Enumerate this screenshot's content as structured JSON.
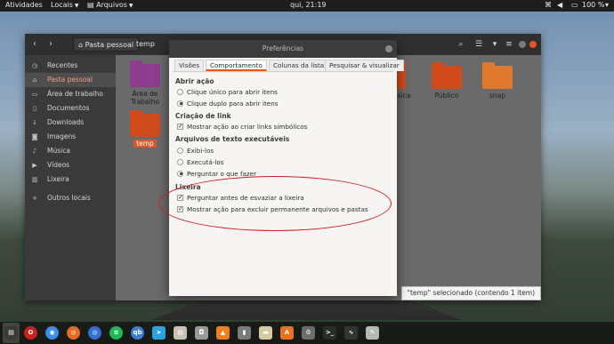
{
  "topbar": {
    "activities": "Atividades",
    "locais": "Locais",
    "arquivos": "Arquivos",
    "clock": "qui, 21:19",
    "battery": "100 %"
  },
  "nautilus": {
    "back_icon": "chevron-left-icon",
    "breadcrumb_home": "Pasta pessoal",
    "breadcrumb_temp": "temp",
    "sidebar": [
      {
        "icon": "clock-icon",
        "label": "Recentes"
      },
      {
        "icon": "home-icon",
        "label": "Pasta pessoal"
      },
      {
        "icon": "desktop-icon",
        "label": "Área de trabalho"
      },
      {
        "icon": "document-icon",
        "label": "Documentos"
      },
      {
        "icon": "download-icon",
        "label": "Downloads"
      },
      {
        "icon": "camera-icon",
        "label": "Imagens"
      },
      {
        "icon": "music-icon",
        "label": "Música"
      },
      {
        "icon": "video-icon",
        "label": "Vídeos"
      },
      {
        "icon": "trash-icon",
        "label": "Lixeira"
      },
      {
        "icon": "plus-icon",
        "label": "Outros locais"
      }
    ],
    "folders": [
      {
        "label": "Área de Trabalho",
        "color": "#8e3c8e"
      },
      {
        "label": "temp",
        "color": "#d14a1c"
      },
      {
        "label": "úsica",
        "color": "#d14a1c"
      },
      {
        "label": "Público",
        "color": "#d14a1c"
      },
      {
        "label": "snap",
        "color": "#e0782e"
      }
    ],
    "status": "\"temp\" selecionado  (contendo 1 item)"
  },
  "dialog": {
    "title": "Preferências",
    "tabs": [
      "Visões",
      "Comportamento",
      "Colunas da lista",
      "Pesquisar & visualizar"
    ],
    "sections": {
      "abrir": {
        "title": "Abrir ação",
        "options": [
          "Clique único para abrir itens",
          "Clique duplo para abrir itens"
        ]
      },
      "link": {
        "title": "Criação de link",
        "options": [
          "Mostrar ação ao criar links simbólicos"
        ]
      },
      "exec": {
        "title": "Arquivos de texto executáveis",
        "options": [
          "Exibi-los",
          "Executá-los",
          "Perguntar o que fazer"
        ]
      },
      "lixeira": {
        "title": "Lixeira",
        "options": [
          "Perguntar antes de esvaziar a lixeira",
          "Mostrar ação para excluir permanente arquivos e pastas"
        ]
      }
    }
  },
  "dock": [
    {
      "icon": "opera-icon",
      "glyph": "O",
      "color": "#cc1f1f"
    },
    {
      "icon": "chrome-icon",
      "glyph": "◉",
      "color": "#3a8ee6"
    },
    {
      "icon": "firefox-icon",
      "glyph": "◎",
      "color": "#e66a1f"
    },
    {
      "icon": "firefox-dev-icon",
      "glyph": "◎",
      "color": "#2f6fd6"
    },
    {
      "icon": "spotify-icon",
      "glyph": "≋",
      "color": "#1db954"
    },
    {
      "icon": "qbittorrent-icon",
      "glyph": "qb",
      "color": "#3b7ed3"
    },
    {
      "icon": "telegram-icon",
      "glyph": "➤",
      "color": "#2aa3df"
    },
    {
      "icon": "files-icon",
      "glyph": "▤",
      "color": "#c9c2b4"
    },
    {
      "icon": "screenshot-icon",
      "glyph": "◘",
      "color": "#9a9a9a"
    },
    {
      "icon": "vlc-icon",
      "glyph": "▲",
      "color": "#f07f1a"
    },
    {
      "icon": "usb-icon",
      "glyph": "▮",
      "color": "#7a7a7a"
    },
    {
      "icon": "notes-icon",
      "glyph": "▬",
      "color": "#d6cba0"
    },
    {
      "icon": "software-icon",
      "glyph": "A",
      "color": "#e8721e"
    },
    {
      "icon": "settings-icon",
      "glyph": "⚙",
      "color": "#6c6c6c"
    },
    {
      "icon": "terminal-icon",
      "glyph": ">_",
      "color": "#2b2b2b"
    },
    {
      "icon": "system-monitor-icon",
      "glyph": "∿",
      "color": "#333333"
    },
    {
      "icon": "update-icon",
      "glyph": "✎",
      "color": "#b8b8b8"
    }
  ]
}
